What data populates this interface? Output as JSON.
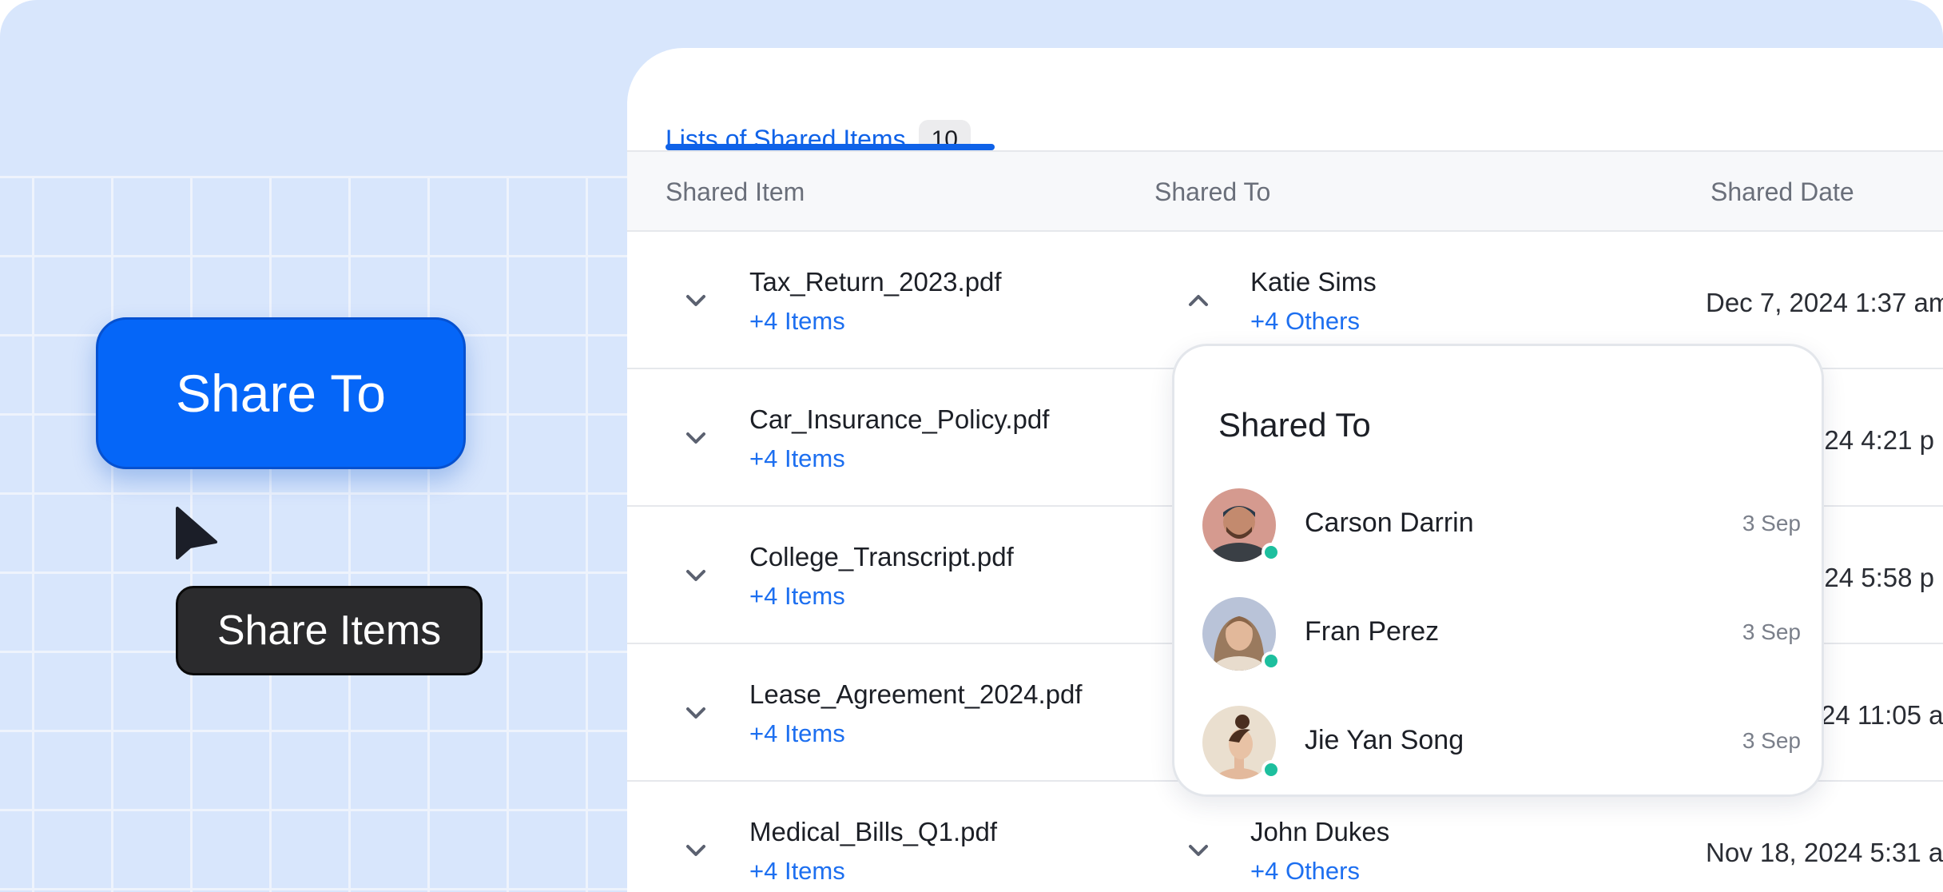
{
  "promo": {
    "share_to_button": "Share To",
    "tooltip": "Share Items"
  },
  "tabs": [
    {
      "label": "Lists of Shared Items",
      "count": "10",
      "active": true
    }
  ],
  "table": {
    "columns": [
      "Shared Item",
      "Shared To",
      "Shared Date"
    ],
    "rows": [
      {
        "file": "Tax_Return_2023.pdf",
        "items": "+4 Items",
        "person": "Katie Sims",
        "others": "+4 Others",
        "date": "Dec 7, 2024 1:37 am",
        "expanded": true
      },
      {
        "file": "Car_Insurance_Policy.pdf",
        "items": "+4 Items",
        "person": "",
        "others": "",
        "date": "024 4:21 p"
      },
      {
        "file": "College_Transcript.pdf",
        "items": "+4 Items",
        "person": "",
        "others": "",
        "date": "024 5:58 p"
      },
      {
        "file": "Lease_Agreement_2024.pdf",
        "items": "+4 Items",
        "person": "",
        "others": "",
        "date": "24 11:05 a"
      },
      {
        "file": "Medical_Bills_Q1.pdf",
        "items": "+4 Items",
        "person": "John Dukes",
        "others": "+4 Others",
        "date": "Nov 18, 2024 5:31 a"
      }
    ]
  },
  "popup": {
    "title": "Shared To",
    "people": [
      {
        "name": "Carson Darrin",
        "date": "3 Sep",
        "online": true
      },
      {
        "name": "Fran Perez",
        "date": "3 Sep",
        "online": true
      },
      {
        "name": "Jie Yan Song",
        "date": "3 Sep",
        "online": true
      }
    ]
  },
  "colors": {
    "accent": "#0566f8",
    "link": "#1d6ff0",
    "background": "#d8e6fc",
    "online": "#1dbf9e"
  }
}
